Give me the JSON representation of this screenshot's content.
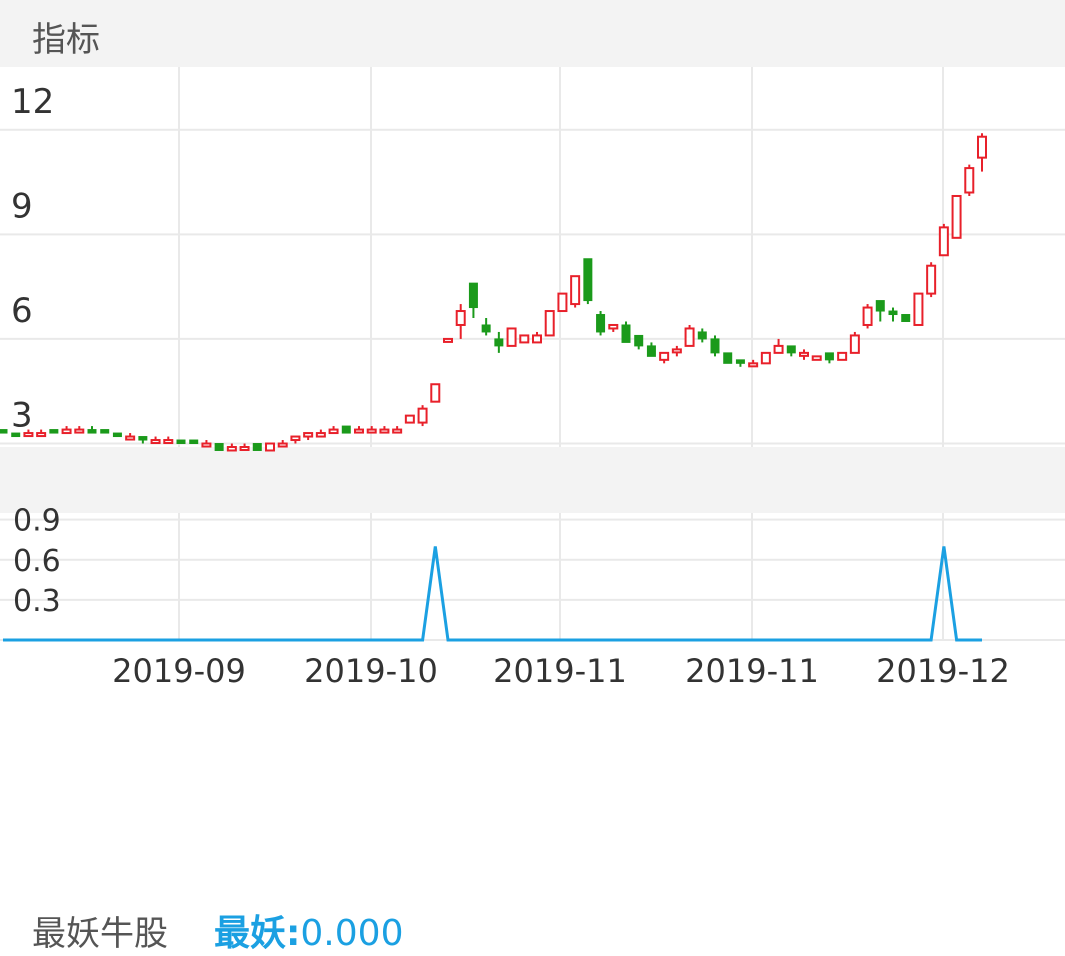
{
  "header": {
    "title": "指标"
  },
  "indicator": {
    "name": "最妖牛股",
    "label": "最妖:",
    "value": "0.000"
  },
  "colors": {
    "up": "#e8202a",
    "down": "#1b9a1b",
    "line": "#1ba0e2",
    "grid": "#e9e9e9",
    "band": "#f3f3f3"
  },
  "chart_data": [
    {
      "type": "candlestick",
      "title": "",
      "y_ticks": [
        "3",
        "6",
        "9",
        "12"
      ],
      "ylim": [
        2.9,
        13.8
      ],
      "grid": true,
      "candles": [
        [
          3.4,
          3.4,
          3.3,
          3.3
        ],
        [
          3.3,
          3.3,
          3.2,
          3.2
        ],
        [
          3.3,
          3.4,
          3.3,
          3.3
        ],
        [
          3.3,
          3.4,
          3.2,
          3.3
        ],
        [
          3.4,
          3.4,
          3.3,
          3.3
        ],
        [
          3.3,
          3.5,
          3.3,
          3.4
        ],
        [
          3.4,
          3.5,
          3.4,
          3.4
        ],
        [
          3.4,
          3.5,
          3.3,
          3.3
        ],
        [
          3.4,
          3.4,
          3.3,
          3.3
        ],
        [
          3.3,
          3.3,
          3.2,
          3.2
        ],
        [
          3.2,
          3.3,
          3.1,
          3.2
        ],
        [
          3.2,
          3.2,
          3.0,
          3.1
        ],
        [
          3.1,
          3.2,
          3.0,
          3.1
        ],
        [
          3.1,
          3.2,
          3.0,
          3.1
        ],
        [
          3.1,
          3.1,
          3.0,
          3.0
        ],
        [
          3.1,
          3.1,
          3.0,
          3.0
        ],
        [
          3.0,
          3.1,
          3.0,
          3.0
        ],
        [
          3.0,
          3.0,
          2.8,
          2.8
        ],
        [
          2.8,
          3.0,
          2.8,
          2.9
        ],
        [
          2.9,
          3.0,
          2.9,
          2.9
        ],
        [
          3.0,
          3.0,
          2.8,
          2.8
        ],
        [
          2.8,
          3.0,
          2.8,
          3.0
        ],
        [
          3.0,
          3.1,
          2.9,
          3.0
        ],
        [
          3.1,
          3.2,
          3.0,
          3.2
        ],
        [
          3.2,
          3.3,
          3.1,
          3.3
        ],
        [
          3.2,
          3.4,
          3.2,
          3.3
        ],
        [
          3.3,
          3.5,
          3.3,
          3.4
        ],
        [
          3.5,
          3.5,
          3.3,
          3.3
        ],
        [
          3.4,
          3.5,
          3.3,
          3.4
        ],
        [
          3.4,
          3.5,
          3.3,
          3.4
        ],
        [
          3.4,
          3.5,
          3.4,
          3.4
        ],
        [
          3.4,
          3.5,
          3.4,
          3.4
        ],
        [
          3.6,
          3.8,
          3.6,
          3.8
        ],
        [
          3.6,
          4.1,
          3.5,
          4.0
        ],
        [
          4.2,
          4.7,
          4.2,
          4.7
        ],
        [
          6.0,
          6.0,
          6.0,
          6.0
        ],
        [
          6.4,
          7.0,
          6.0,
          6.8
        ],
        [
          7.6,
          7.6,
          6.6,
          6.9
        ],
        [
          6.4,
          6.6,
          6.1,
          6.2
        ],
        [
          6.0,
          6.2,
          5.6,
          5.8
        ],
        [
          5.8,
          6.3,
          5.8,
          6.3
        ],
        [
          5.9,
          6.1,
          5.9,
          6.1
        ],
        [
          5.9,
          6.2,
          5.9,
          6.1
        ],
        [
          6.1,
          6.8,
          6.1,
          6.8
        ],
        [
          6.8,
          7.3,
          6.8,
          7.3
        ],
        [
          7.0,
          7.8,
          6.9,
          7.8
        ],
        [
          8.3,
          8.3,
          7.0,
          7.1
        ],
        [
          6.7,
          6.8,
          6.1,
          6.2
        ],
        [
          6.3,
          6.4,
          6.2,
          6.4
        ],
        [
          6.4,
          6.5,
          5.9,
          5.9
        ],
        [
          6.1,
          6.1,
          5.7,
          5.8
        ],
        [
          5.8,
          5.9,
          5.5,
          5.5
        ],
        [
          5.4,
          5.6,
          5.3,
          5.6
        ],
        [
          5.7,
          5.8,
          5.5,
          5.7
        ],
        [
          5.8,
          6.4,
          5.8,
          6.3
        ],
        [
          6.2,
          6.3,
          5.9,
          6.0
        ],
        [
          6.0,
          6.1,
          5.5,
          5.6
        ],
        [
          5.6,
          5.6,
          5.3,
          5.3
        ],
        [
          5.4,
          5.4,
          5.2,
          5.3
        ],
        [
          5.3,
          5.4,
          5.2,
          5.3
        ],
        [
          5.3,
          5.6,
          5.3,
          5.6
        ],
        [
          5.6,
          6.0,
          5.6,
          5.8
        ],
        [
          5.8,
          5.8,
          5.5,
          5.6
        ],
        [
          5.6,
          5.7,
          5.4,
          5.6
        ],
        [
          5.4,
          5.5,
          5.4,
          5.5
        ],
        [
          5.6,
          5.6,
          5.3,
          5.4
        ],
        [
          5.4,
          5.6,
          5.4,
          5.6
        ],
        [
          5.6,
          6.2,
          5.6,
          6.1
        ],
        [
          6.4,
          7.0,
          6.3,
          6.9
        ],
        [
          7.1,
          7.1,
          6.5,
          6.8
        ],
        [
          6.8,
          6.9,
          6.5,
          6.7
        ],
        [
          6.7,
          6.7,
          6.5,
          6.5
        ],
        [
          6.4,
          7.3,
          6.4,
          7.3
        ],
        [
          7.3,
          8.2,
          7.2,
          8.1
        ],
        [
          8.4,
          9.3,
          8.4,
          9.2
        ],
        [
          8.9,
          10.1,
          8.9,
          10.1
        ],
        [
          10.2,
          11.0,
          10.1,
          10.9
        ],
        [
          11.2,
          11.9,
          10.8,
          11.8
        ]
      ]
    },
    {
      "type": "line",
      "title": "",
      "y_ticks": [
        "0.3",
        "0.6",
        "0.9"
      ],
      "ylim": [
        0,
        0.95
      ],
      "grid": true,
      "spikes": [
        [
          34,
          0.7
        ],
        [
          74,
          0.7
        ]
      ],
      "x_ticks": [
        "2019-09",
        "2019-10",
        "2019-11",
        "2019-11",
        "2019-12"
      ],
      "series": [
        {
          "values": []
        }
      ]
    }
  ]
}
